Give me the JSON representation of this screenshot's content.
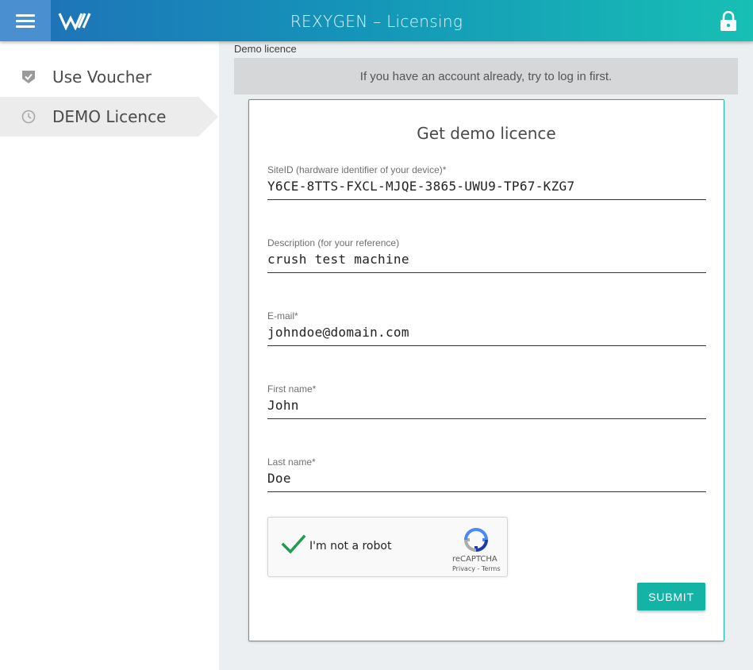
{
  "header": {
    "title": "REXYGEN – Licensing",
    "menu_icon": "hamburger-icon",
    "logo_icon": "rexygen-logo",
    "lock_icon": "lock-icon"
  },
  "sidebar": {
    "items": [
      {
        "label": "Use Voucher",
        "icon": "shield-check-icon",
        "active": false
      },
      {
        "label": "DEMO Licence",
        "icon": "clock-icon",
        "active": true
      }
    ]
  },
  "main": {
    "breadcrumb": "Demo licence",
    "notice": "If you have an account already, try to log in first."
  },
  "form": {
    "title": "Get demo licence",
    "fields": [
      {
        "label": "SiteID (hardware identifier of your device)*",
        "value": "Y6CE-8TTS-FXCL-MJQE-3865-UWU9-TP67-KZG7"
      },
      {
        "label": "Description (for your reference)",
        "value": "crush test machine"
      },
      {
        "label": "E-mail*",
        "value": "johndoe@domain.com"
      },
      {
        "label": "First name*",
        "value": "John"
      },
      {
        "label": "Last name*",
        "value": "Doe"
      }
    ],
    "captcha": {
      "text": "I'm not a robot",
      "brand": "reCAPTCHA",
      "links": "Privacy - Terms",
      "checked": true
    },
    "submit_label": "SUBMIT"
  },
  "colors": {
    "accent": "#13b3a5",
    "header_start": "#1f6fb8",
    "header_end": "#17bfb4",
    "checkmark": "#1e9e4a"
  }
}
